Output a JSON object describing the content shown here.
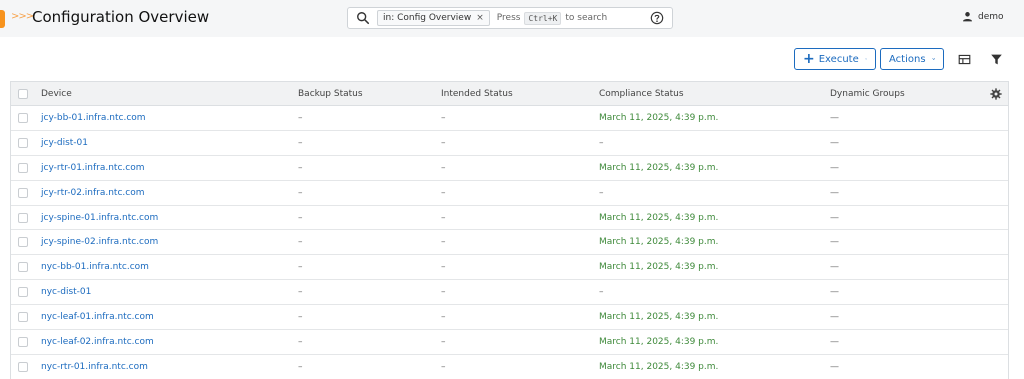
{
  "header": {
    "title": "Configuration Overview",
    "crumb_glyph": ">>>"
  },
  "search": {
    "scope_label": "in: Config Overview",
    "scope_remove": "×",
    "press_text": "Press",
    "shortcut": "Ctrl+K",
    "to_search_text": "to search"
  },
  "user": {
    "name": "demo"
  },
  "toolbar": {
    "execute_label": "Execute",
    "execute_plus": "+",
    "actions_label": "Actions"
  },
  "table": {
    "columns": [
      "Device",
      "Backup Status",
      "Intended Status",
      "Compliance Status",
      "Dynamic Groups"
    ],
    "rows": [
      {
        "device": "jcy-bb-01.infra.ntc.com",
        "backup": "–",
        "intended": "–",
        "compliance": "March 11, 2025, 4:39 p.m.",
        "groups": "—"
      },
      {
        "device": "jcy-dist-01",
        "backup": "–",
        "intended": "–",
        "compliance": "–",
        "groups": "—"
      },
      {
        "device": "jcy-rtr-01.infra.ntc.com",
        "backup": "–",
        "intended": "–",
        "compliance": "March 11, 2025, 4:39 p.m.",
        "groups": "—"
      },
      {
        "device": "jcy-rtr-02.infra.ntc.com",
        "backup": "–",
        "intended": "–",
        "compliance": "–",
        "groups": "—"
      },
      {
        "device": "jcy-spine-01.infra.ntc.com",
        "backup": "–",
        "intended": "–",
        "compliance": "March 11, 2025, 4:39 p.m.",
        "groups": "—"
      },
      {
        "device": "jcy-spine-02.infra.ntc.com",
        "backup": "–",
        "intended": "–",
        "compliance": "March 11, 2025, 4:39 p.m.",
        "groups": "—"
      },
      {
        "device": "nyc-bb-01.infra.ntc.com",
        "backup": "–",
        "intended": "–",
        "compliance": "March 11, 2025, 4:39 p.m.",
        "groups": "—"
      },
      {
        "device": "nyc-dist-01",
        "backup": "–",
        "intended": "–",
        "compliance": "–",
        "groups": "—"
      },
      {
        "device": "nyc-leaf-01.infra.ntc.com",
        "backup": "–",
        "intended": "–",
        "compliance": "March 11, 2025, 4:39 p.m.",
        "groups": "—"
      },
      {
        "device": "nyc-leaf-02.infra.ntc.com",
        "backup": "–",
        "intended": "–",
        "compliance": "March 11, 2025, 4:39 p.m.",
        "groups": "—"
      },
      {
        "device": "nyc-rtr-01.infra.ntc.com",
        "backup": "–",
        "intended": "–",
        "compliance": "March 11, 2025, 4:39 p.m.",
        "groups": "—"
      }
    ]
  },
  "colors": {
    "accent": "#f7931e",
    "link": "#1c6bbf",
    "compliance_ok": "#3f8a3b"
  },
  "icons": [
    "search-icon",
    "help-icon",
    "user-icon",
    "plus-icon",
    "chevron-down-icon",
    "table-layout-icon",
    "filter-icon",
    "gear-icon"
  ]
}
